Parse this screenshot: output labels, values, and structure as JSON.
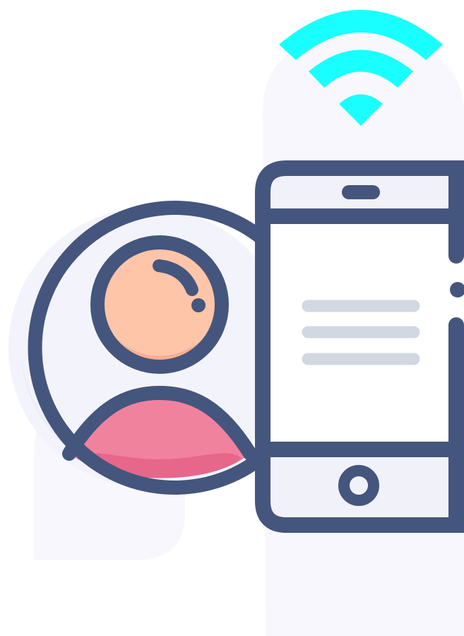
{
  "illustration": {
    "subject": "user-phone-wifi-icon",
    "colors": {
      "outline": "#44567D",
      "background_shape": "#F7F7FD",
      "avatar_circle_fill": "#F3F3FB",
      "head_skin": "#FFC5A8",
      "head_skin_shade": "#F8AF91",
      "body_pink": "#F1829E",
      "body_pink_shade": "#E6678A",
      "wifi": "#19FFFF",
      "phone_screen": "#FFFFFF",
      "phone_bezel": "#F1F1F9",
      "text_lines": "#D2D8E2"
    },
    "icons": [
      "wifi-signal-icon",
      "user-avatar-icon",
      "smartphone-icon"
    ]
  }
}
